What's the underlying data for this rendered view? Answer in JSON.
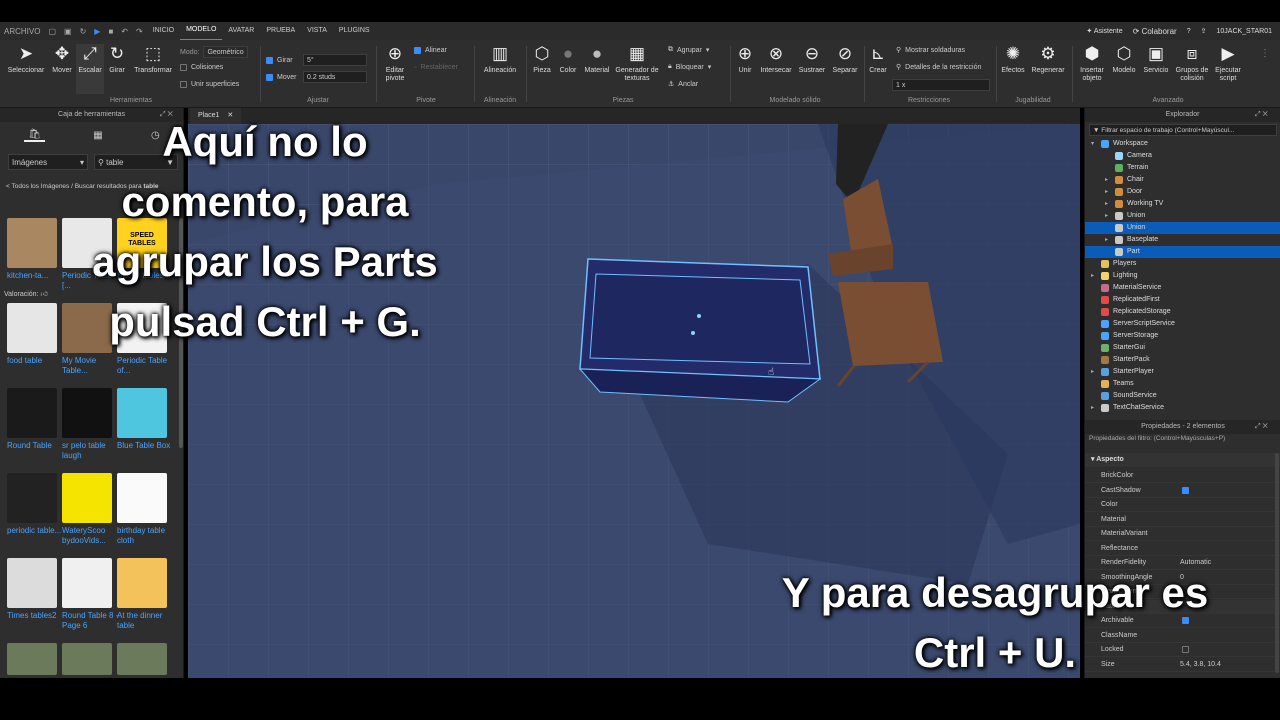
{
  "menubar": {
    "items": [
      "ARCHIVO",
      "INICIO",
      "MODELO",
      "AVATAR",
      "PRUEBA",
      "VISTA",
      "PLUGINS"
    ],
    "active": "MODELO",
    "assistant": "Asistente",
    "collaborate": "Colaborar",
    "user": "10JACK_STAR01"
  },
  "ribbon": {
    "tools": {
      "select": "Seleccionar",
      "move": "Mover",
      "scale": "Escalar",
      "rotate": "Girar",
      "transform": "Transformar"
    },
    "mode_label": "Modo:",
    "mode_value": "Geométrico",
    "collisions": "Colisiones",
    "join_surfaces": "Unir superficies",
    "rotate_label": "Girar",
    "rotate_value": "5°",
    "move_label": "Mover",
    "move_value": "0.2 studs",
    "edit_pivot": "Editar pivote",
    "align_label": "Alinear",
    "reset_label": "Restablecer",
    "alignment": "Alineación",
    "part": "Pieza",
    "color": "Color",
    "material": "Material",
    "texture_gen": "Generador de texturas",
    "group": "Agrupar",
    "lock": "Bloquear",
    "anchor": "Anclar",
    "union": "Unir",
    "intersect": "Intersecar",
    "subtract": "Sustraer",
    "separate": "Separar",
    "create": "Crear",
    "show_welds": "Mostrar soldaduras",
    "constraint_details": "Detalles de la restricción",
    "scale_value": "1 x",
    "effects": "Efectos",
    "regen": "Regenerar",
    "insert_object": "Insertar objeto",
    "model": "Modelo",
    "service": "Servicio",
    "collision_groups": "Grupos de colisión",
    "run_script": "Ejecutar script",
    "groups": {
      "tools": "Herramientas",
      "adjust": "Ajustar",
      "pivot": "Pivote",
      "alignment": "Alineación",
      "parts": "Piezas",
      "solid": "Modelado sólido",
      "constraints": "Restricciones",
      "gameplay": "Jugabilidad",
      "advanced": "Avanzado"
    }
  },
  "toolbox": {
    "title": "Caja de herramientas",
    "category": "Imágenes",
    "search": "table",
    "breadcrumb": "< Todos los Imágenes / Buscar resultados para",
    "breadcrumb_term": "table",
    "rating_label": "Valoración:",
    "items": [
      {
        "label": "kitchen-ta..."
      },
      {
        "label": "Periodic Table [..."
      },
      {
        "label": "Speed tables..."
      },
      {
        "label": "food table"
      },
      {
        "label": "My Movie Table..."
      },
      {
        "label": "Periodic Table of..."
      },
      {
        "label": "Round Table"
      },
      {
        "label": "sr pelo table laugh"
      },
      {
        "label": "Blue Table Box"
      },
      {
        "label": "periodic table..."
      },
      {
        "label": "WateryScoo bydooVids..."
      },
      {
        "label": "birthday table cloth"
      },
      {
        "label": "Times tables2"
      },
      {
        "label": "Round Table 8 - Page 6"
      },
      {
        "label": "At the dinner table"
      }
    ],
    "speed_sign_text": "SPEED TABLES"
  },
  "tab": {
    "label": "Place1"
  },
  "explorer": {
    "title": "Explorador",
    "filter": "Filtrar espacio de trabajo (Control+Mayúscul...",
    "nodes": [
      {
        "label": "Workspace",
        "color": "#4aa3ff"
      },
      {
        "label": "Camera",
        "color": "#9bd4ff"
      },
      {
        "label": "Terrain",
        "color": "#5fb05f"
      },
      {
        "label": "Chair",
        "color": "#d38c3a"
      },
      {
        "label": "Door",
        "color": "#d38c3a"
      },
      {
        "label": "Working TV",
        "color": "#d38c3a"
      },
      {
        "label": "Union",
        "color": "#c9c9c9"
      },
      {
        "label": "Union",
        "color": "#c9c9c9"
      },
      {
        "label": "Baseplate",
        "color": "#c9c9c9"
      },
      {
        "label": "Part",
        "color": "#c9c9c9"
      },
      {
        "label": "Players",
        "color": "#e0c25a"
      },
      {
        "label": "Lighting",
        "color": "#f2d46b"
      },
      {
        "label": "MaterialService",
        "color": "#c46a8a"
      },
      {
        "label": "ReplicatedFirst",
        "color": "#e24a4a"
      },
      {
        "label": "ReplicatedStorage",
        "color": "#e24a4a"
      },
      {
        "label": "ServerScriptService",
        "color": "#4aa3ff"
      },
      {
        "label": "ServerStorage",
        "color": "#4aa3ff"
      },
      {
        "label": "StarterGui",
        "color": "#6fb06f"
      },
      {
        "label": "StarterPack",
        "color": "#a37a44"
      },
      {
        "label": "StarterPlayer",
        "color": "#5aa0e0"
      },
      {
        "label": "Teams",
        "color": "#e0b25a"
      },
      {
        "label": "SoundService",
        "color": "#5aa0e0"
      },
      {
        "label": "TextChatService",
        "color": "#c9c9c9"
      }
    ]
  },
  "properties": {
    "title": "Propiedades - 2 elementos",
    "filter": "Propiedades del filtro: (Control+Mayúsculas+P)",
    "section": "Aspecto",
    "rows": [
      {
        "name": "BrickColor",
        "value": ""
      },
      {
        "name": "CastShadow",
        "value": ""
      },
      {
        "name": "Color",
        "value": ""
      },
      {
        "name": "Material",
        "value": ""
      },
      {
        "name": "MaterialVariant",
        "value": ""
      },
      {
        "name": "Reflectance",
        "value": ""
      },
      {
        "name": "RenderFidelity",
        "value": "Automatic"
      },
      {
        "name": "SmoothingAngle",
        "value": "0"
      },
      {
        "name": "Transparency",
        "value": ""
      },
      {
        "name": "Datos",
        "value": ""
      },
      {
        "name": "Archivable",
        "value": ""
      },
      {
        "name": "ClassName",
        "value": ""
      },
      {
        "name": "Locked",
        "value": ""
      },
      {
        "name": "Size",
        "value": "5.4, 3.8, 10.4"
      }
    ]
  },
  "captions": {
    "top": "Aquí no lo comento, para agrupar los Parts pulsad Ctrl + G.",
    "bottom": "Y para desagrupar es Ctrl + U."
  }
}
